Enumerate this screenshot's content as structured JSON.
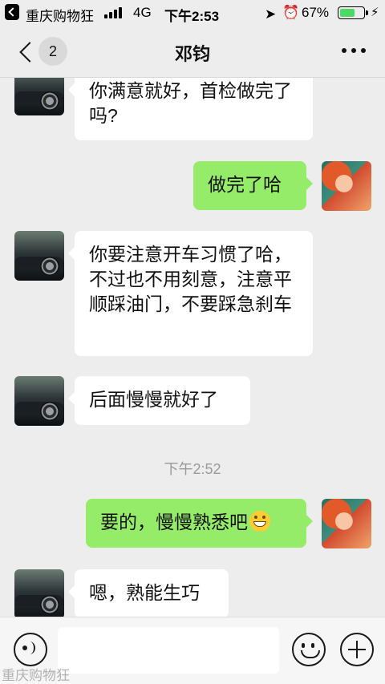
{
  "status_bar": {
    "carrier": "重庆购物狂",
    "network": "4G",
    "time": "下午2:53",
    "battery_percent": "67%",
    "battery_level": 0.67,
    "icons": [
      "back-to-app-icon",
      "signal-icon",
      "location-icon",
      "alarm-icon",
      "battery-icon",
      "charging-icon"
    ]
  },
  "nav": {
    "back_count": "2",
    "title": "邓钧"
  },
  "messages": [
    {
      "side": "in",
      "text": "你满意就好，首检做完了吗?"
    },
    {
      "side": "out",
      "text": "做完了哈"
    },
    {
      "side": "in",
      "text": "你要注意开车习惯了哈，不过也不用刻意，注意平顺踩油门，不要踩急刹车"
    },
    {
      "side": "in",
      "text": "后面慢慢就好了"
    },
    {
      "side": "time",
      "text": "下午2:52"
    },
    {
      "side": "out",
      "text": "要的，慢慢熟悉吧",
      "emoji": "grinning-face"
    },
    {
      "side": "in",
      "text": "嗯，熟能生巧"
    }
  ],
  "input_bar": {
    "placeholder": "",
    "watermark": "重庆购物狂"
  },
  "colors": {
    "background": "#ededed",
    "outgoing_bubble": "#95ec69",
    "incoming_bubble": "#ffffff",
    "battery_fill": "#4cd964"
  }
}
